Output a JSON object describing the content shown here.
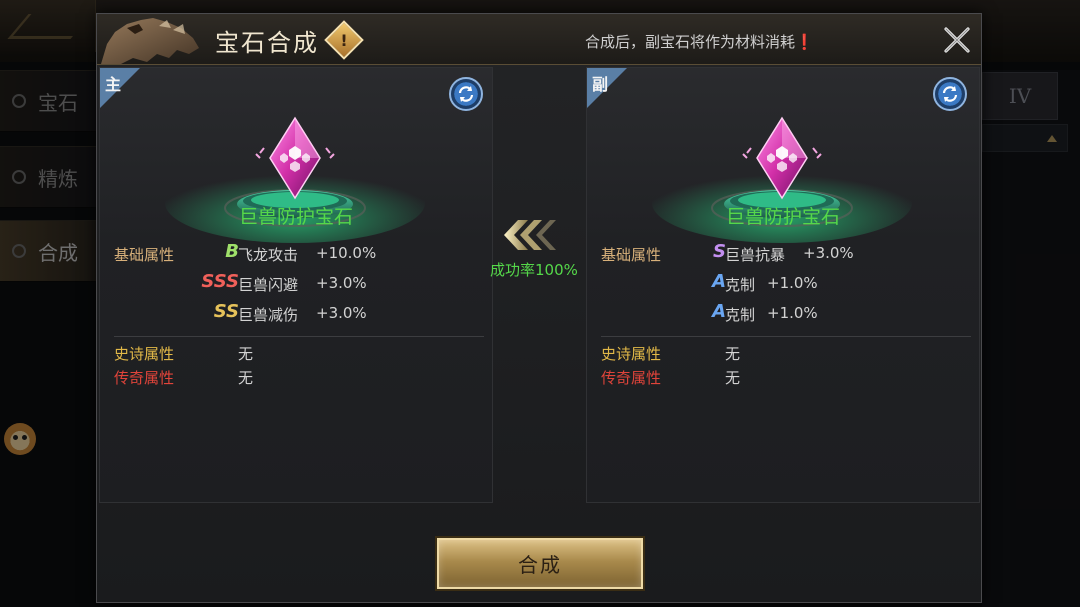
{
  "background": {
    "side_tabs": [
      {
        "label": "宝石"
      },
      {
        "label": "精炼"
      },
      {
        "label": "合成"
      }
    ],
    "roman_tab": "IV"
  },
  "dialog": {
    "title": "宝石合成",
    "notice": "合成后，副宝石将作为材料消耗❗",
    "success_rate": "成功率100%",
    "confirm_label": "合成",
    "primary": {
      "corner_label": "主",
      "gem_name": "巨兽防护宝石",
      "base_label": "基础属性",
      "base_attrs": [
        {
          "grade": "B",
          "stat": "飞龙攻击",
          "value": "+10.0%",
          "grade_color": "#9fe06a"
        },
        {
          "grade": "SSS",
          "stat": "巨兽闪避",
          "value": "+3.0%",
          "grade_color": "#f0605a"
        },
        {
          "grade": "SS",
          "stat": "巨兽减伤",
          "value": "+3.0%",
          "grade_color": "#e6c25a"
        }
      ],
      "epic_label": "史诗属性",
      "epic_value": "无",
      "legend_label": "传奇属性",
      "legend_value": "无"
    },
    "secondary": {
      "corner_label": "副",
      "gem_name": "巨兽防护宝石",
      "base_label": "基础属性",
      "base_attrs": [
        {
          "grade": "S",
          "stat": "巨兽抗暴",
          "value": "+3.0%",
          "grade_color": "#c38ff0"
        },
        {
          "grade": "A",
          "stat": "克制",
          "value": "+1.0%",
          "grade_color": "#6aa6f2"
        },
        {
          "grade": "A",
          "stat": "克制",
          "value": "+1.0%",
          "grade_color": "#6aa6f2"
        }
      ],
      "epic_label": "史诗属性",
      "epic_value": "无",
      "legend_label": "传奇属性",
      "legend_value": "无"
    }
  },
  "icons": [
    "back-arrow-icon",
    "gem-icon",
    "warning-icon",
    "close-icon",
    "refresh-icon",
    "merge-arrow-icon",
    "mascot-icon"
  ]
}
